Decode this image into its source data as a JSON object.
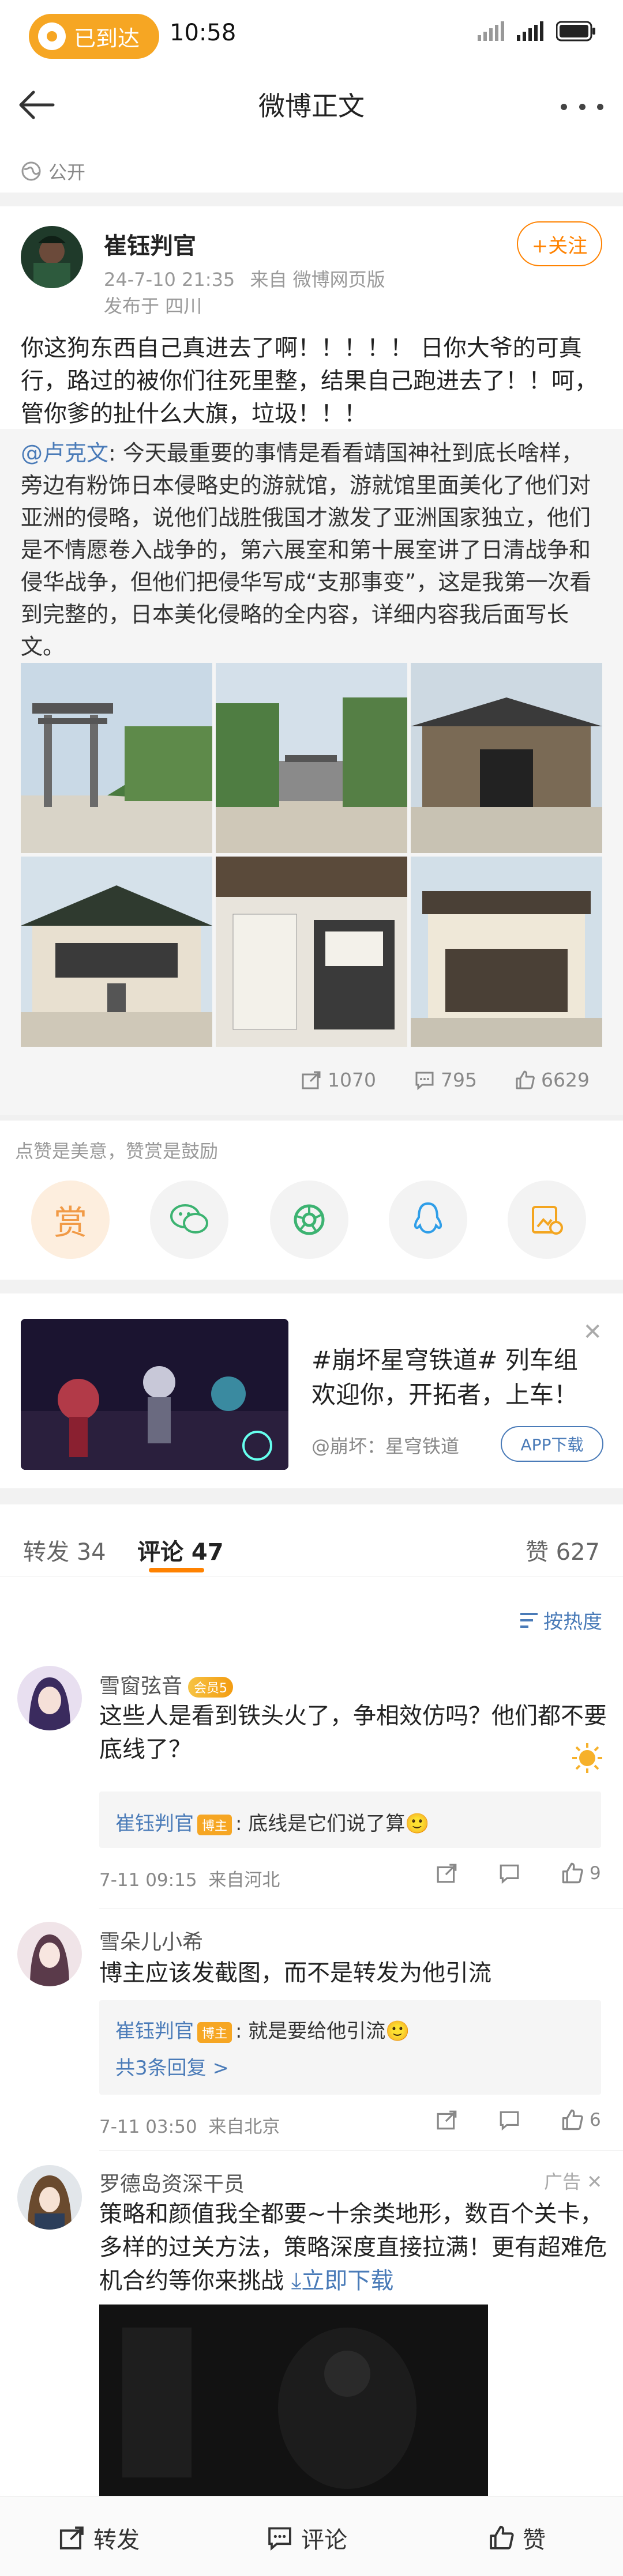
{
  "status_bar": {
    "location_pill": "已到达",
    "time": "10:58",
    "battery": "100"
  },
  "nav": {
    "title": "微博正文"
  },
  "visibility": "公开",
  "post": {
    "author": "崔钰判官",
    "timestamp": "24-7-10 21:35",
    "source": "来自 微博网页版",
    "location": "发布于 四川",
    "follow_label": "+关注",
    "text": "你这狗东西自己真进去了啊！！！！！ 日你大爷的可真行，路过的被你们往死里整，结果自己跑进去了！！呵，管你爹的扯什么大旗，垃圾！！！",
    "repost": {
      "mention": "@卢克文",
      "text": ": 今天最重要的事情是看看靖国神社到底长啥样，旁边有粉饰日本侵略史的游就馆，游就馆里面美化了他们对亚洲的侵略，说他们战胜俄国才激发了亚洲国家独立，他们是不情愿卷入战争的，第六展室和第十展室讲了日清战争和侵华战争，但他们把侵华写成“支那事变”，这是我第一次看到完整的，日本美化侵略的全内容，详细内容我后面写长文。",
      "shares": "1070",
      "comments": "795",
      "likes": "6629"
    }
  },
  "like_hint": "点赞是美意，赞赏是鼓励",
  "reward_label": "赏",
  "share_icons": [
    "wechat-icon",
    "moments-icon",
    "qq-icon",
    "qzone-icon"
  ],
  "ad": {
    "title": "#崩坏星穹铁道# 列车组欢迎你，开拓者，上车！",
    "source": "@崩坏：星穹铁道",
    "button": "APP下载"
  },
  "tabs": {
    "repost": "转发 34",
    "comments": "评论 47",
    "likes": "赞 627"
  },
  "sort_label": "按热度",
  "comments": [
    {
      "name": "雪窗弦音",
      "vip": "会员5",
      "text": "这些人是看到铁头火了，争相效仿吗？他们都不要底线了？",
      "reply_author": "崔钰判官",
      "reply_badge": "博主",
      "reply_text": ": 底线是它们说了算🙂",
      "time": "7-11 09:15",
      "from": "来自河北",
      "likes": "9"
    },
    {
      "name": "雪朵儿小希",
      "text": "博主应该发截图，而不是转发为他引流",
      "reply_author": "崔钰判官",
      "reply_badge": "博主",
      "reply_text": ": 就是要给他引流🙂",
      "more_replies": "共3条回复 >",
      "time": "7-11 03:50",
      "from": "来自北京",
      "likes": "6"
    }
  ],
  "ad_comment": {
    "name": "罗德岛资深干员",
    "tag": "广告",
    "text": "策略和颜值我全都要~十余类地形，数百个关卡，多样的过关方法，策略深度直接拉满！更有超难危机合约等你来挑战",
    "link": "⤓立即下载"
  },
  "bottom_bar": {
    "repost": "转发",
    "comment": "评论",
    "like": "赞"
  },
  "colors": {
    "accent_orange": "#ff8200",
    "link_blue": "#4a7bb8",
    "pill_orange": "#f6a623"
  }
}
